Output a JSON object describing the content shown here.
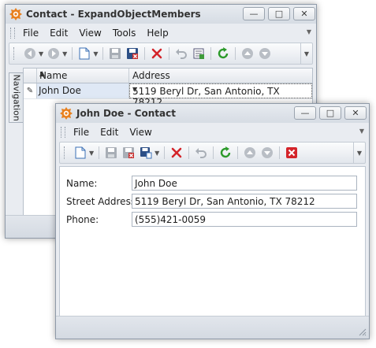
{
  "colors": {
    "delete_red": "#d4242a",
    "refresh_green": "#2c9a2a",
    "save_close_red": "#c8302f",
    "title_icon_orange": "#e8801e",
    "disabled_gray": "#a8aeb6"
  },
  "window_main": {
    "title": "Contact - ExpandObjectMembers",
    "controls": {
      "minimize": "—",
      "maximize": "□",
      "close": "✕"
    },
    "menu": [
      "File",
      "Edit",
      "View",
      "Tools",
      "Help"
    ],
    "navigation_label": "Navigation",
    "grid": {
      "columns": [
        {
          "label": "Name",
          "sort": "▲"
        },
        {
          "label": "Address"
        }
      ],
      "rows": [
        {
          "indicator": "✎",
          "name": "John Doe",
          "address": "5119 Beryl Dr,  San Antonio, TX 78212"
        }
      ],
      "dropdown_glyph": "▼"
    }
  },
  "window_detail": {
    "title": "John Doe - Contact",
    "controls": {
      "minimize": "—",
      "maximize": "□",
      "close": "✕"
    },
    "menu": [
      "File",
      "Edit",
      "View"
    ],
    "fields": [
      {
        "label": "Name:",
        "value": "John Doe"
      },
      {
        "label": "Street Address:",
        "value": "5119 Beryl Dr,  San Antonio, TX 78212"
      },
      {
        "label": "Phone:",
        "value": "(555)421-0059"
      }
    ]
  },
  "icons": {
    "back": "back-arrow-icon",
    "forward": "forward-arrow-icon",
    "new": "new-document-icon",
    "save": "save-icon",
    "save_close": "save-and-close-icon",
    "delete": "delete-icon",
    "undo": "undo-icon",
    "export": "export-icon",
    "refresh": "refresh-icon",
    "prev": "previous-record-icon",
    "next": "next-record-icon",
    "close_red": "close-red-icon"
  }
}
